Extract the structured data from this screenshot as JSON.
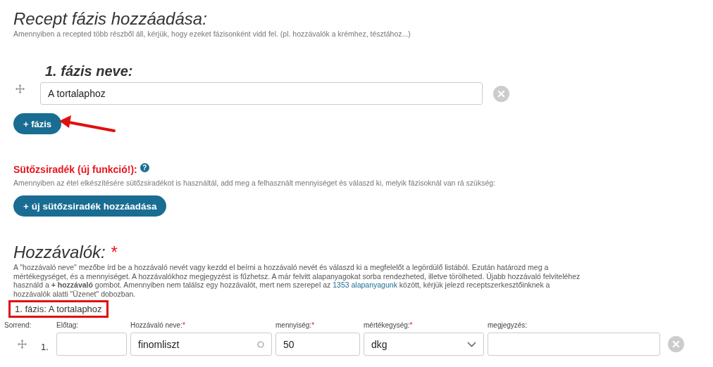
{
  "phases_section": {
    "title": "Recept fázis hozzáadása:",
    "hint": "Amennyiben a recepted több részből áll, kérjük, hogy ezeket fázisonként vidd fel. (pl. hozzávalók a krémhez, tésztához...)",
    "phases": [
      {
        "label": "1. fázis neve:",
        "value": "A tortalaphoz"
      }
    ],
    "add_button": "+ fázis"
  },
  "fat_section": {
    "title": "Sütőzsiradék (új funkció!):",
    "help": "?",
    "hint": "Amennyiben az étel elkészítésére sütőzsiradékot is használtál, add meg a felhasznált mennyiséget és válaszd ki, melyik fázisoknál van rá szükség:",
    "add_button": "+ új sütőzsiradék hozzáadása"
  },
  "ingredients_section": {
    "title": "Hozzávalók:",
    "title_mark": "*",
    "description": {
      "before": "A \"hozzávaló neve\" mezőbe írd be a hozzávaló nevét vagy kezdd el beírni a hozzávaló nevét és válaszd ki a megfelelőt a legördülő listából. Ezután határozd meg a mértékegységet, és a mennyiséget. A hozzávalókhoz megjegyzést is fűzhetsz. A már felvitt alapanyagokat sorba rendezheted, illetve törölheted. Újabb hozzávaló felviteléhez használd a **+ hozzávaló** gombot. Amennyiben nem találsz egy hozzávalót, mert nem szerepel az",
      "link": "1353 alapanyagunk",
      "after": "között, kérjük jelezd receptszerkesztőinknek a hozzávalók alatti \"Üzenet\" dobozban."
    },
    "phase_label": "1. fázis: A tortalaphoz",
    "columns": [
      {
        "label": "Sorrend:"
      },
      {
        "label": "Előtag:"
      },
      {
        "label": "Hozzávaló neve:",
        "mark": "*"
      },
      {
        "label": "mennyiség:",
        "mark": "*"
      },
      {
        "label": "mértékegység:",
        "mark": "*"
      },
      {
        "label": "megjegyzés:"
      }
    ],
    "rows": [
      {
        "index": "1.",
        "name": "finomliszt",
        "amount": "50",
        "unit": "dkg"
      }
    ]
  }
}
